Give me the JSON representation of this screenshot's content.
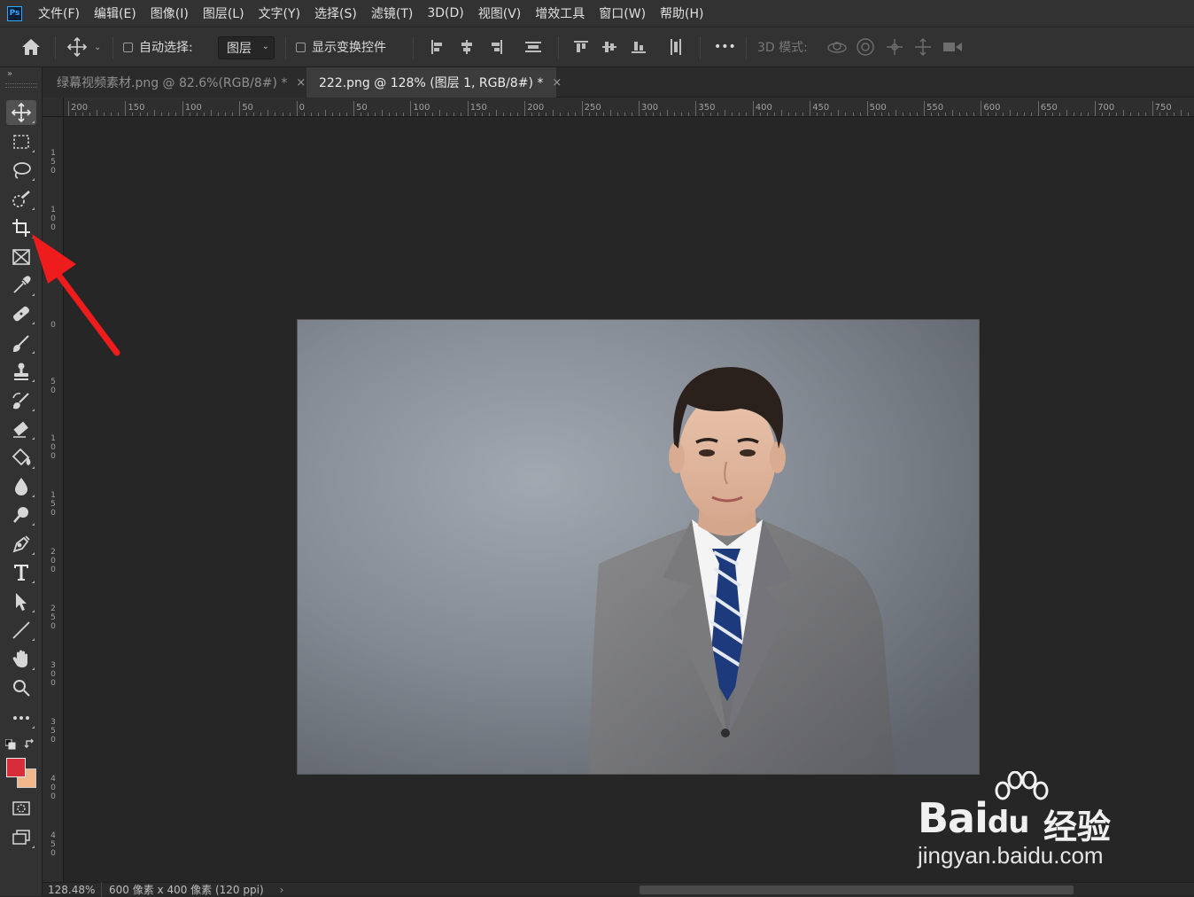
{
  "app": {
    "logo": "Ps"
  },
  "menu": [
    "文件(F)",
    "编辑(E)",
    "图像(I)",
    "图层(L)",
    "文字(Y)",
    "选择(S)",
    "滤镜(T)",
    "3D(D)",
    "视图(V)",
    "增效工具",
    "窗口(W)",
    "帮助(H)"
  ],
  "options": {
    "auto_select_label": "自动选择:",
    "auto_select_value": "图层",
    "show_transform_label": "显示变换控件",
    "more_label": "•••",
    "mode3d_label": "3D 模式:"
  },
  "tabs": [
    {
      "label": "绿幕视频素材.png @ 82.6%(RGB/8#) *",
      "close": "×",
      "active": false
    },
    {
      "label": "222.png @ 128% (图层 1, RGB/8#) *",
      "close": "×",
      "active": true
    }
  ],
  "ruler_top": [
    "200",
    "150",
    "100",
    "50",
    "0",
    "50",
    "100",
    "150",
    "200",
    "250",
    "300",
    "350",
    "400",
    "450",
    "500",
    "550",
    "600",
    "650",
    "700",
    "750"
  ],
  "ruler_left": [
    "150",
    "100",
    "0",
    "50",
    "100",
    "150",
    "200",
    "250",
    "300",
    "350",
    "400",
    "450"
  ],
  "tools": [
    "move-tool",
    "marquee-tool",
    "lasso-tool",
    "quick-select-tool",
    "crop-tool",
    "frame-tool",
    "eyedropper-tool",
    "healing-tool",
    "brush-tool",
    "stamp-tool",
    "history-brush-tool",
    "eraser-tool",
    "paint-bucket-tool",
    "blur-tool",
    "dodge-tool",
    "pen-tool",
    "type-tool",
    "path-select-tool",
    "line-tool",
    "hand-tool",
    "zoom-tool",
    "more-tools"
  ],
  "colors": {
    "foreground": "#d72d3a",
    "background": "#f0b88a",
    "arrow": "#ee1c1c"
  },
  "status": {
    "zoom": "128.48%",
    "info": "600 像素 x 400 像素 (120 ppi)",
    "more": "›"
  },
  "watermark": {
    "brand": "Bai",
    "du": "du",
    "sub": "经验",
    "url": "jingyan.baidu.com"
  }
}
